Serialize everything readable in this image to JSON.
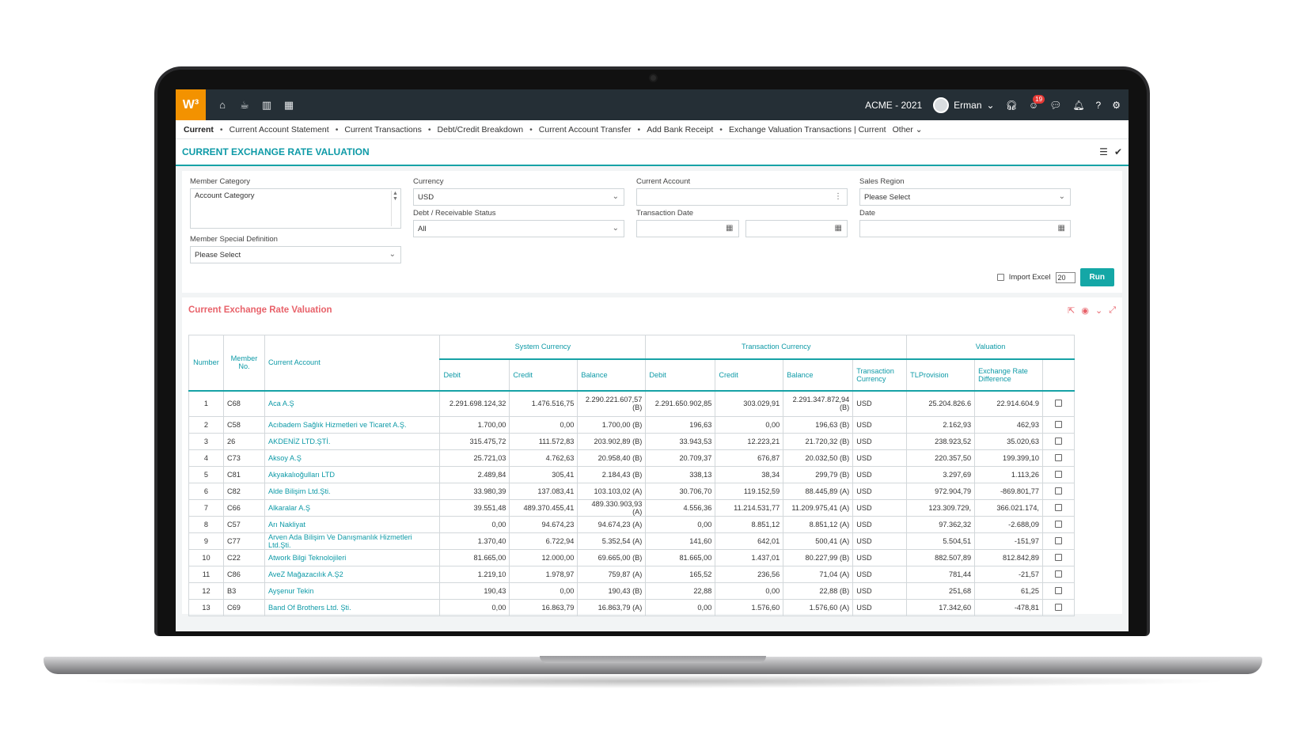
{
  "topbar": {
    "logo": "W³",
    "company": "ACME - 2021",
    "user": "Erman",
    "notification_count": "19"
  },
  "menu": {
    "items": [
      "Current",
      "Current Account Statement",
      "Current Transactions",
      "Debt/Credit Breakdown",
      "Current Account Transfer",
      "Add Bank Receipt",
      "Exchange Valuation Transactions | Current",
      "Other"
    ]
  },
  "page": {
    "title": "CURRENT EXCHANGE RATE VALUATION"
  },
  "filters": {
    "member_category_label": "Member Category",
    "member_category_value": "Account Category",
    "member_special_label": "Member Special Definition",
    "member_special_value": "Please Select",
    "currency_label": "Currency",
    "currency_value": "USD",
    "debt_status_label": "Debt / Receivable Status",
    "debt_status_value": "All",
    "current_account_label": "Current Account",
    "current_account_value": "",
    "transaction_date_label": "Transaction Date",
    "sales_region_label": "Sales Region",
    "sales_region_value": "Please Select",
    "date_label": "Date",
    "import_excel_label": "Import Excel",
    "page_size": "20",
    "run_label": "Run"
  },
  "panel": {
    "title": "Current Exchange Rate Valuation"
  },
  "table": {
    "group_headers": {
      "number": "Number",
      "member_no": "Member No.",
      "current_account": "Current Account",
      "system_currency": "System Currency",
      "transaction_currency": "Transaction Currency",
      "valuation": "Valuation"
    },
    "sub_headers": {
      "sys_debit": "Debit",
      "sys_credit": "Credit",
      "sys_balance": "Balance",
      "tr_debit": "Debit",
      "tr_credit": "Credit",
      "tr_balance": "Balance",
      "tr_currency": "Transaction Currency",
      "tl_provision": "TLProvision",
      "exch_diff": "Exchange Rate Difference"
    },
    "rows": [
      {
        "n": "1",
        "m": "C68",
        "acc": "Aca A.Ş",
        "sd": "2.291.698.124,32",
        "sc": "1.476.516,75",
        "sb": "2.290.221.607,57 (B)",
        "td": "2.291.650.902,85",
        "tc": "303.029,91",
        "tb": "2.291.347.872,94 (B)",
        "cur": "USD",
        "tl": "25.204.826.6",
        "ed": "22.914.604.9"
      },
      {
        "n": "2",
        "m": "C58",
        "acc": "Acıbadem Sağlık Hizmetleri ve Ticaret A.Ş.",
        "sd": "1.700,00",
        "sc": "0,00",
        "sb": "1.700,00 (B)",
        "td": "196,63",
        "tc": "0,00",
        "tb": "196,63 (B)",
        "cur": "USD",
        "tl": "2.162,93",
        "ed": "462,93"
      },
      {
        "n": "3",
        "m": "26",
        "acc": "AKDENİZ LTD.ŞTİ.",
        "sd": "315.475,72",
        "sc": "111.572,83",
        "sb": "203.902,89 (B)",
        "td": "33.943,53",
        "tc": "12.223,21",
        "tb": "21.720,32 (B)",
        "cur": "USD",
        "tl": "238.923,52",
        "ed": "35.020,63"
      },
      {
        "n": "4",
        "m": "C73",
        "acc": "Aksoy A.Ş",
        "sd": "25.721,03",
        "sc": "4.762,63",
        "sb": "20.958,40 (B)",
        "td": "20.709,37",
        "tc": "676,87",
        "tb": "20.032,50 (B)",
        "cur": "USD",
        "tl": "220.357,50",
        "ed": "199.399,10"
      },
      {
        "n": "5",
        "m": "C81",
        "acc": "Akyakalıoğulları LTD",
        "sd": "2.489,84",
        "sc": "305,41",
        "sb": "2.184,43 (B)",
        "td": "338,13",
        "tc": "38,34",
        "tb": "299,79 (B)",
        "cur": "USD",
        "tl": "3.297,69",
        "ed": "1.113,26"
      },
      {
        "n": "6",
        "m": "C82",
        "acc": "Alde Bilişim Ltd.Şti.",
        "sd": "33.980,39",
        "sc": "137.083,41",
        "sb": "103.103,02 (A)",
        "td": "30.706,70",
        "tc": "119.152,59",
        "tb": "88.445,89 (A)",
        "cur": "USD",
        "tl": "972.904,79",
        "ed": "-869.801,77"
      },
      {
        "n": "7",
        "m": "C66",
        "acc": "Alkaralar A.Ş",
        "sd": "39.551,48",
        "sc": "489.370.455,41",
        "sb": "489.330.903,93 (A)",
        "td": "4.556,36",
        "tc": "11.214.531,77",
        "tb": "11.209.975,41 (A)",
        "cur": "USD",
        "tl": "123.309.729,",
        "ed": "366.021.174,"
      },
      {
        "n": "8",
        "m": "C57",
        "acc": "Arı Nakliyat",
        "sd": "0,00",
        "sc": "94.674,23",
        "sb": "94.674,23 (A)",
        "td": "0,00",
        "tc": "8.851,12",
        "tb": "8.851,12 (A)",
        "cur": "USD",
        "tl": "97.362,32",
        "ed": "-2.688,09"
      },
      {
        "n": "9",
        "m": "C77",
        "acc": "Arven Ada Bilişim Ve Danışmanlık Hizmetleri Ltd.Şti.",
        "sd": "1.370,40",
        "sc": "6.722,94",
        "sb": "5.352,54 (A)",
        "td": "141,60",
        "tc": "642,01",
        "tb": "500,41 (A)",
        "cur": "USD",
        "tl": "5.504,51",
        "ed": "-151,97"
      },
      {
        "n": "10",
        "m": "C22",
        "acc": "Atwork Bilgi Teknolojileri",
        "sd": "81.665,00",
        "sc": "12.000,00",
        "sb": "69.665,00 (B)",
        "td": "81.665,00",
        "tc": "1.437,01",
        "tb": "80.227,99 (B)",
        "cur": "USD",
        "tl": "882.507,89",
        "ed": "812.842,89"
      },
      {
        "n": "11",
        "m": "C86",
        "acc": "AveZ Mağazacılık A.Ş2",
        "sd": "1.219,10",
        "sc": "1.978,97",
        "sb": "759,87 (A)",
        "td": "165,52",
        "tc": "236,56",
        "tb": "71,04 (A)",
        "cur": "USD",
        "tl": "781,44",
        "ed": "-21,57"
      },
      {
        "n": "12",
        "m": "B3",
        "acc": "Ayşenur Tekin",
        "sd": "190,43",
        "sc": "0,00",
        "sb": "190,43 (B)",
        "td": "22,88",
        "tc": "0,00",
        "tb": "22,88 (B)",
        "cur": "USD",
        "tl": "251,68",
        "ed": "61,25"
      },
      {
        "n": "13",
        "m": "C69",
        "acc": "Band Of Brothers Ltd. Şti.",
        "sd": "0,00",
        "sc": "16.863,79",
        "sb": "16.863,79 (A)",
        "td": "0,00",
        "tc": "1.576,60",
        "tb": "1.576,60 (A)",
        "cur": "USD",
        "tl": "17.342,60",
        "ed": "-478,81"
      }
    ]
  }
}
